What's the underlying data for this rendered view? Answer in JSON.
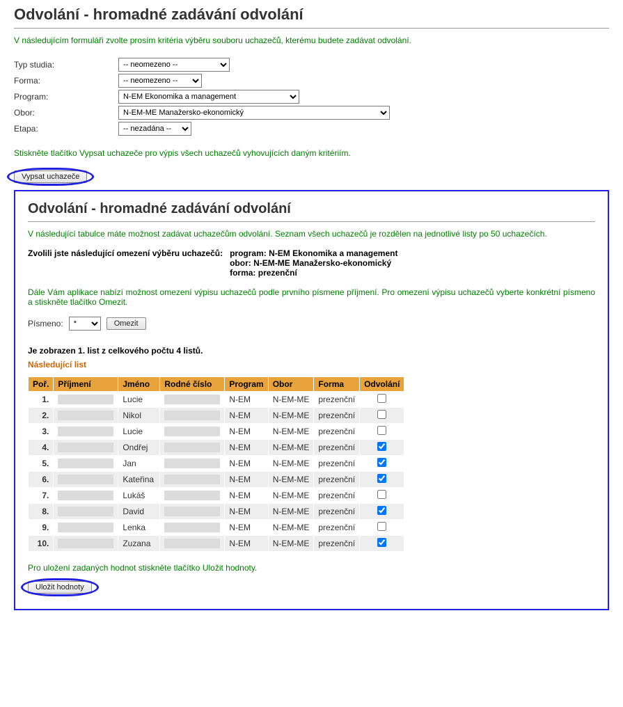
{
  "page": {
    "title": "Odvolání - hromadné zadávání odvolání"
  },
  "intro": "V následujícím formuláři zvolte prosím kritéria výběru souboru uchazečů, kterému budete zadávat odvolání.",
  "form": {
    "labels": {
      "typ": "Typ studia:",
      "forma": "Forma:",
      "program": "Program:",
      "obor": "Obor:",
      "etapa": "Etapa:"
    },
    "values": {
      "typ": "-- neomezeno --",
      "forma": "-- neomezeno --",
      "program": "N-EM Ekonomika a management",
      "obor": "N-EM-ME Manažersko-ekonomický",
      "etapa": "-- nezadána --"
    }
  },
  "hint1": "Stiskněte tlačítko Vypsat uchazeče pro výpis všech uchazečů vyhovujících daným kritériím.",
  "buttons": {
    "vypsat": "Vypsat uchazeče",
    "omezit": "Omezit",
    "ulozit": "Uložit hodnoty"
  },
  "panel": {
    "title": "Odvolání - hromadné zadávání odvolání",
    "intro": "V následující tabulce máte možnost zadávat uchazečům odvolání. Seznam všech uchazečů je rozdělen na jednotlivé listy po 50 uchazečích.",
    "restriction_label": "Zvolili jste následující omezení výběru uchazečů:",
    "restrictions": {
      "r1": "program: N-EM Ekonomika a management",
      "r2": "obor: N-EM-ME Manažersko-ekonomický",
      "r3": "forma: prezenční"
    },
    "filter_hint": "Dále Vám aplikace nabízí možnost omezení výpisu uchazečů podle prvního písmene příjmení. Pro omezení výpisu uchazečů vyberte konkrétní písmeno a stiskněte tlačítko Omezit.",
    "letter_label": "Písmeno:",
    "letter_value": "*",
    "list_info": "Je zobrazen 1. list z celkového počtu 4 listů.",
    "next_link": "Následující list",
    "save_hint": "Pro uložení zadaných hodnot stiskněte tlačítko Uložit hodnoty."
  },
  "table": {
    "headers": {
      "por": "Poř.",
      "prijmeni": "Příjmení",
      "jmeno": "Jméno",
      "rc": "Rodné číslo",
      "program": "Program",
      "obor": "Obor",
      "forma": "Forma",
      "odvolani": "Odvolání"
    },
    "rows": [
      {
        "por": "1.",
        "jmeno": "Lucie",
        "program": "N-EM",
        "obor": "N-EM-ME",
        "forma": "prezenční",
        "odvolani": false
      },
      {
        "por": "2.",
        "jmeno": "Nikol",
        "program": "N-EM",
        "obor": "N-EM-ME",
        "forma": "prezenční",
        "odvolani": false
      },
      {
        "por": "3.",
        "jmeno": "Lucie",
        "program": "N-EM",
        "obor": "N-EM-ME",
        "forma": "prezenční",
        "odvolani": false
      },
      {
        "por": "4.",
        "jmeno": "Ondřej",
        "program": "N-EM",
        "obor": "N-EM-ME",
        "forma": "prezenční",
        "odvolani": true
      },
      {
        "por": "5.",
        "jmeno": "Jan",
        "program": "N-EM",
        "obor": "N-EM-ME",
        "forma": "prezenční",
        "odvolani": true
      },
      {
        "por": "6.",
        "jmeno": "Kateřina",
        "program": "N-EM",
        "obor": "N-EM-ME",
        "forma": "prezenční",
        "odvolani": true
      },
      {
        "por": "7.",
        "jmeno": "Lukáš",
        "program": "N-EM",
        "obor": "N-EM-ME",
        "forma": "prezenční",
        "odvolani": false
      },
      {
        "por": "8.",
        "jmeno": "David",
        "program": "N-EM",
        "obor": "N-EM-ME",
        "forma": "prezenční",
        "odvolani": true
      },
      {
        "por": "9.",
        "jmeno": "Lenka",
        "program": "N-EM",
        "obor": "N-EM-ME",
        "forma": "prezenční",
        "odvolani": false
      },
      {
        "por": "10.",
        "jmeno": "Zuzana",
        "program": "N-EM",
        "obor": "N-EM-ME",
        "forma": "prezenční",
        "odvolani": true
      }
    ]
  }
}
